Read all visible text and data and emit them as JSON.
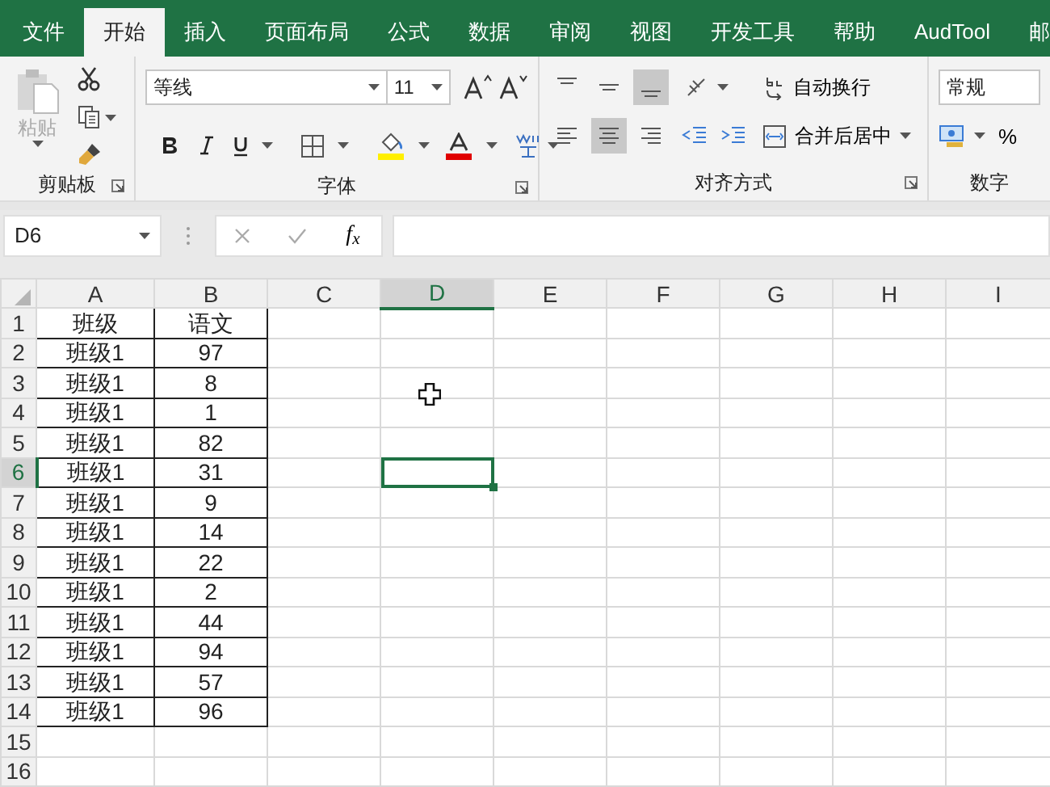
{
  "ribbon_tabs": [
    {
      "label": "文件",
      "selected": false
    },
    {
      "label": "开始",
      "selected": true
    },
    {
      "label": "插入",
      "selected": false
    },
    {
      "label": "页面布局",
      "selected": false
    },
    {
      "label": "公式",
      "selected": false
    },
    {
      "label": "数据",
      "selected": false
    },
    {
      "label": "审阅",
      "selected": false
    },
    {
      "label": "视图",
      "selected": false
    },
    {
      "label": "开发工具",
      "selected": false
    },
    {
      "label": "帮助",
      "selected": false
    },
    {
      "label": "AudTool",
      "selected": false
    },
    {
      "label": "邮",
      "selected": false
    }
  ],
  "clipboard": {
    "paste": {
      "label": "粘贴",
      "disabled": true
    },
    "group_label": "剪贴板"
  },
  "font": {
    "font_name": "等线",
    "font_size": "11",
    "group_label": "字体"
  },
  "alignment": {
    "vertical_buttons": [
      {
        "kind": "top",
        "selected": false
      },
      {
        "kind": "middle",
        "selected": false
      },
      {
        "kind": "bottom",
        "selected": true
      }
    ],
    "horizontal_buttons": [
      {
        "kind": "left",
        "selected": false
      },
      {
        "kind": "center",
        "selected": true
      },
      {
        "kind": "right",
        "selected": false
      }
    ],
    "wrap_text": "自动换行",
    "merge_center": "合并后居中",
    "group_label": "对齐方式"
  },
  "number": {
    "format": "常规",
    "percent": "%",
    "group_label": "数字"
  },
  "formula_bar": {
    "name_box": "D6",
    "function_label": "f$_{x}$"
  },
  "sheet": {
    "columns": [
      {
        "label": "A",
        "selected": false
      },
      {
        "label": "B",
        "selected": false
      },
      {
        "label": "C",
        "selected": false
      },
      {
        "label": "D",
        "selected": true
      },
      {
        "label": "E",
        "selected": false
      },
      {
        "label": "F",
        "selected": false
      },
      {
        "label": "G",
        "selected": false
      },
      {
        "label": "H",
        "selected": false
      },
      {
        "label": "I",
        "selected": false
      }
    ],
    "rows": [
      {
        "header": "1",
        "selected": false,
        "bordered": true,
        "cells": [
          "班级",
          "语文"
        ]
      },
      {
        "header": "2",
        "selected": false,
        "bordered": true,
        "cells": [
          "班级1",
          "97"
        ]
      },
      {
        "header": "3",
        "selected": false,
        "bordered": true,
        "cells": [
          "班级1",
          "8"
        ]
      },
      {
        "header": "4",
        "selected": false,
        "bordered": true,
        "cells": [
          "班级1",
          "1"
        ]
      },
      {
        "header": "5",
        "selected": false,
        "bordered": true,
        "cells": [
          "班级1",
          "82"
        ]
      },
      {
        "header": "6",
        "selected": true,
        "bordered": true,
        "cells": [
          "班级1",
          "31"
        ]
      },
      {
        "header": "7",
        "selected": false,
        "bordered": true,
        "cells": [
          "班级1",
          "9"
        ]
      },
      {
        "header": "8",
        "selected": false,
        "bordered": true,
        "cells": [
          "班级1",
          "14"
        ]
      },
      {
        "header": "9",
        "selected": false,
        "bordered": true,
        "cells": [
          "班级1",
          "22"
        ]
      },
      {
        "header": "10",
        "selected": false,
        "bordered": true,
        "cells": [
          "班级1",
          "2"
        ]
      },
      {
        "header": "11",
        "selected": false,
        "bordered": true,
        "cells": [
          "班级1",
          "44"
        ]
      },
      {
        "header": "12",
        "selected": false,
        "bordered": true,
        "cells": [
          "班级1",
          "94"
        ]
      },
      {
        "header": "13",
        "selected": false,
        "bordered": true,
        "cells": [
          "班级1",
          "57"
        ]
      },
      {
        "header": "14",
        "selected": false,
        "bordered": true,
        "cells": [
          "班级1",
          "96"
        ]
      },
      {
        "header": "15",
        "selected": false,
        "bordered": false,
        "cells": []
      },
      {
        "header": "16",
        "selected": false,
        "bordered": false,
        "cells": []
      }
    ]
  }
}
